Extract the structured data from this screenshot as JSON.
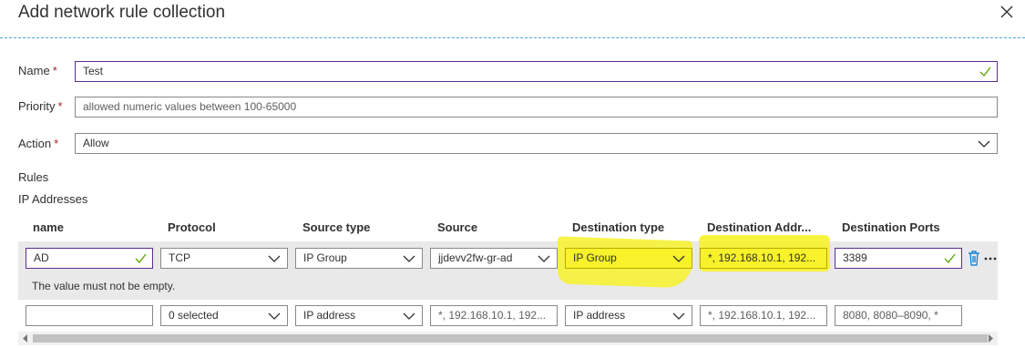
{
  "header": {
    "title": "Add network rule collection"
  },
  "form": {
    "name": {
      "label": "Name",
      "required": "*",
      "value": "Test"
    },
    "priority": {
      "label": "Priority",
      "required": "*",
      "placeholder": "allowed numeric values between 100-65000"
    },
    "action": {
      "label": "Action",
      "required": "*",
      "value": "Allow"
    }
  },
  "rules": {
    "section_label": "Rules",
    "subsection_label": "IP Addresses",
    "columns": [
      "name",
      "Protocol",
      "Source type",
      "Source",
      "Destination type",
      "Destination Addr...",
      "Destination Ports"
    ],
    "row1": {
      "name": "AD",
      "protocol": "TCP",
      "source_type": "IP Group",
      "source": "jjdevv2fw-gr-ad",
      "destination_type": "IP Group",
      "destination_address": "*, 192.168.10.1, 192...",
      "destination_ports": "3389",
      "error": "The value must not be empty."
    },
    "row2": {
      "name": "",
      "protocol": "0 selected",
      "source_type": "IP address",
      "source_placeholder": "*, 192.168.10.1, 192...",
      "destination_type": "IP address",
      "destination_address_placeholder": "*, 192.168.10.1, 192...",
      "destination_ports_placeholder": "8080, 8080–8090, *"
    }
  },
  "colors": {
    "valid_border": "#5c2d91",
    "highlight": "#f7f22a",
    "divider": "#4aa8d8"
  },
  "icons": [
    "close-icon",
    "check-icon",
    "chevron-down-icon",
    "trash-icon",
    "more-icon"
  ]
}
